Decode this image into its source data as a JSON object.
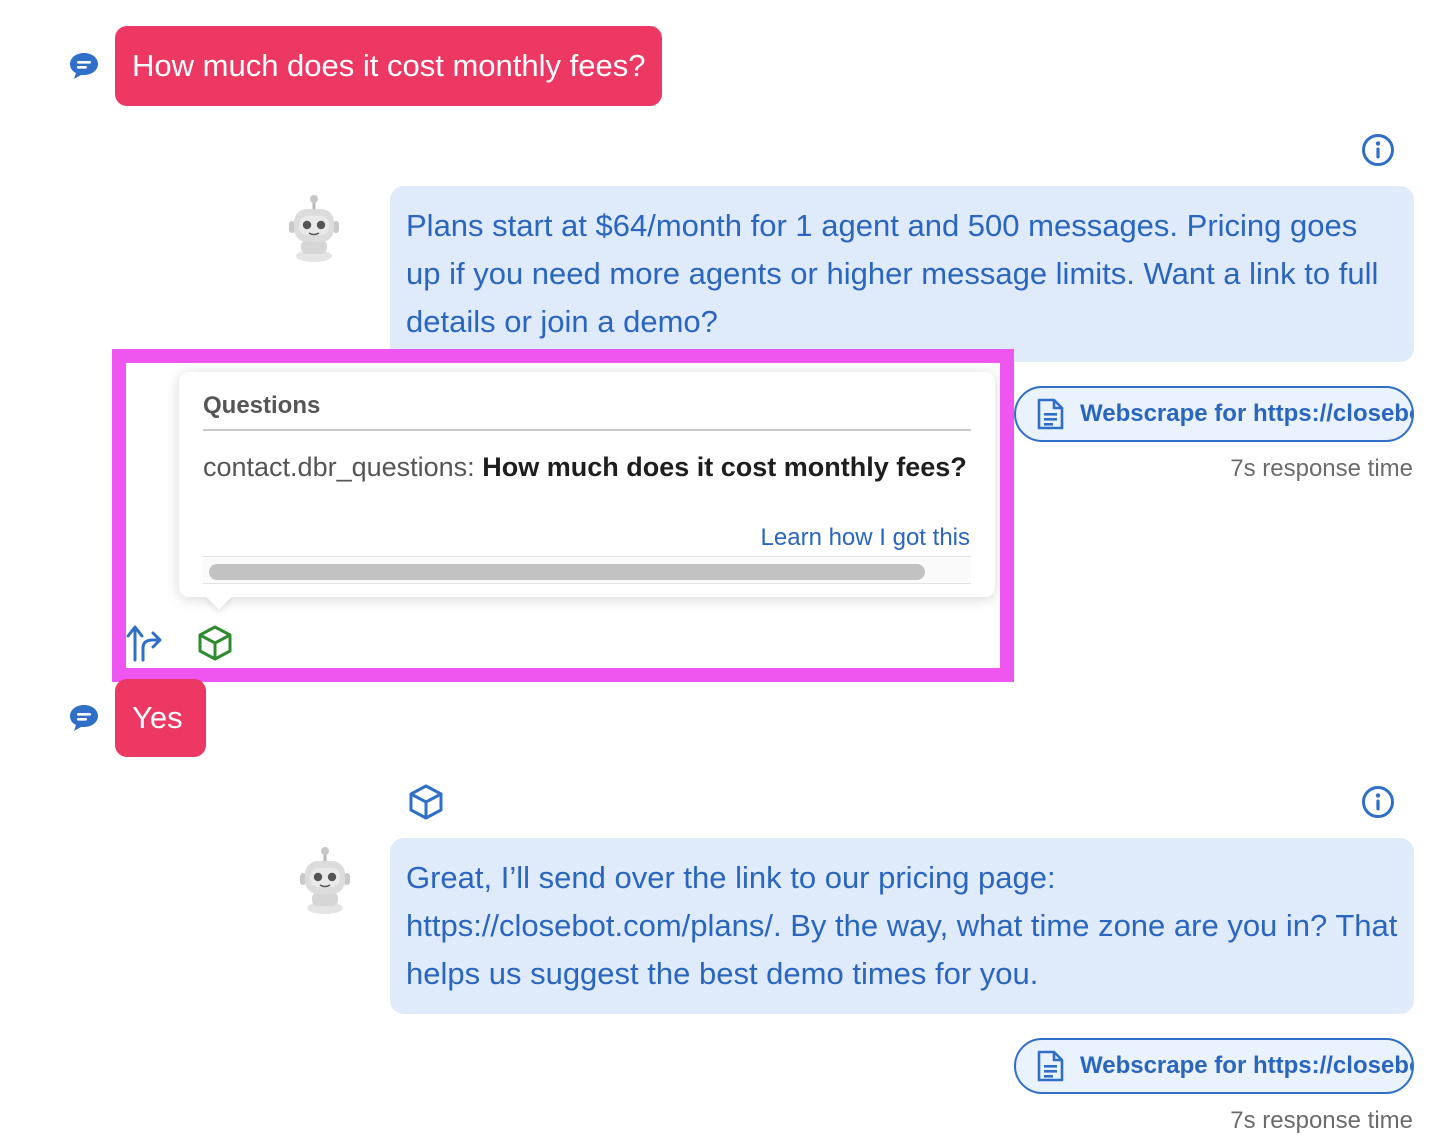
{
  "messages": {
    "user_1": "How much does it cost monthly fees?",
    "bot_1": "Plans start at $64/month for 1 agent and 500 messages. Pricing goes up if you need more agents or higher message limits. Want a link to full details or join a demo?",
    "user_2": "Yes",
    "bot_2": "Great, I’ll send over the link to our pricing page: https://closebot.com/plans/. By the way, what time zone are you in? That helps us suggest the best demo times for you."
  },
  "sources": {
    "source_1_label": "Webscrape for https://closebot.com/plans/",
    "source_2_label": "Webscrape for https://closebot.com/plans/",
    "response_time_1": "7s response time",
    "response_time_2": "7s response time"
  },
  "popover": {
    "title": "Questions",
    "field_key": "contact.dbr_questions:",
    "field_value": "How much does it cost monthly fees?",
    "learn_link": "Learn how I got this"
  },
  "colors": {
    "user_bubble": "#ec3862",
    "bot_bubble": "#dfeafb",
    "bot_text": "#2a66c0",
    "highlight": "#ef55ef",
    "cube_green": "#2e8b2e"
  },
  "icons": [
    "chat-bubble-icon",
    "robot-avatar",
    "info-icon",
    "document-icon",
    "branch-arrows-icon",
    "cube-icon"
  ]
}
